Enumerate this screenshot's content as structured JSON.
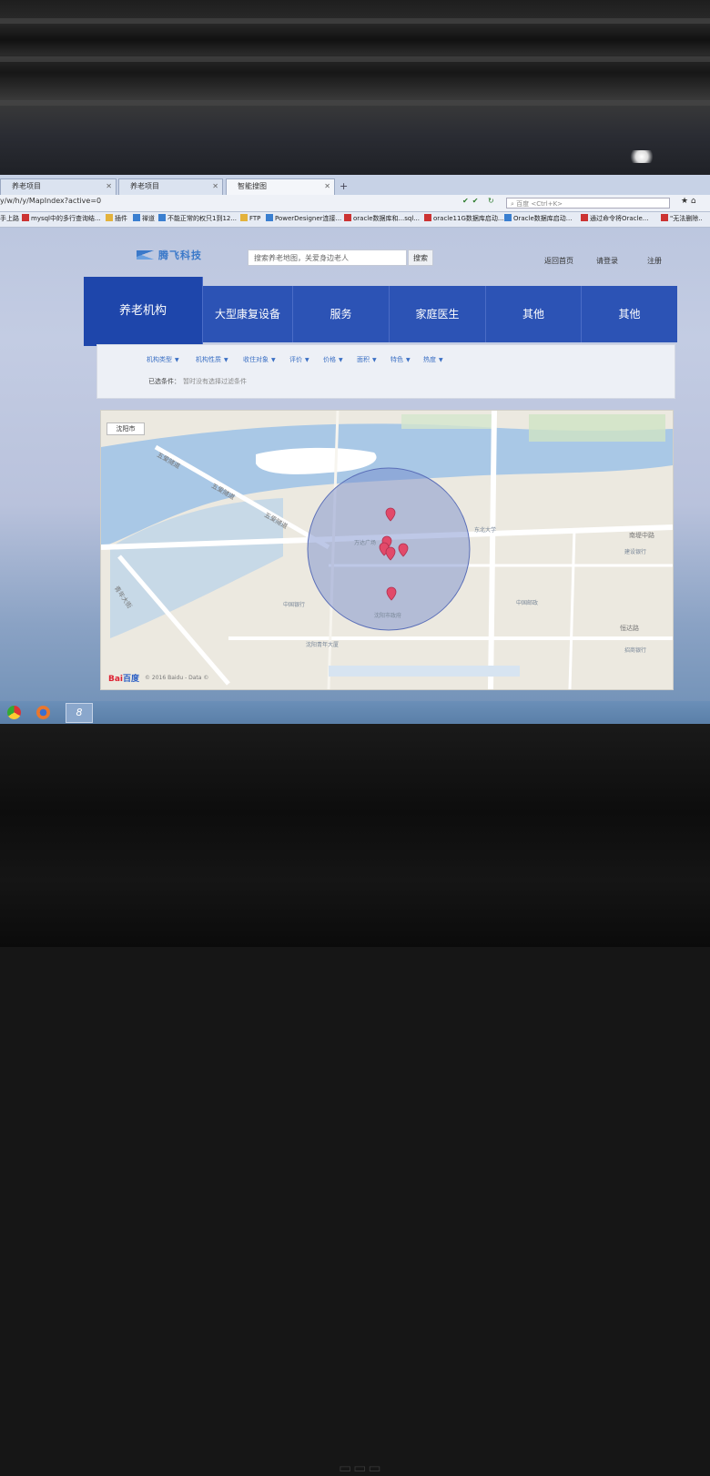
{
  "browser": {
    "tabs": [
      {
        "label": "养老项目",
        "active": false
      },
      {
        "label": "养老项目",
        "active": false
      },
      {
        "label": "智能搜图",
        "active": true
      }
    ],
    "url": "y/w/h/y/MapIndex?active=0",
    "search_placeholder": "百度 <Ctrl+K>",
    "bookmarks": [
      {
        "label": "手上路",
        "icon": "bookmark-icon"
      },
      {
        "label": "mysql中的多行查询结...",
        "icon": "doc-icon"
      },
      {
        "label": "插件",
        "icon": "folder-icon"
      },
      {
        "label": "禅道",
        "icon": "bookmark-icon"
      },
      {
        "label": "不能正常的权只1到12...",
        "icon": "doc-icon"
      },
      {
        "label": "FTP",
        "icon": "folder-icon"
      },
      {
        "label": "PowerDesigner连接...",
        "icon": "doc-icon"
      },
      {
        "label": "oracle数据库和...sql...",
        "icon": "doc-icon"
      },
      {
        "label": "oracle11G数据库启动...",
        "icon": "doc-icon"
      },
      {
        "label": "Oracle数据库启动...",
        "icon": "doc-icon"
      },
      {
        "label": "通过命令将Oracle...",
        "icon": "doc-icon"
      },
      {
        "label": "\"无法删除..",
        "icon": "doc-icon"
      }
    ]
  },
  "site": {
    "logo": "腾飞科技",
    "search_placeholder": "搜索养老地图，关爱身边老人",
    "search_button": "搜索",
    "links": [
      "返回首页",
      "请登录",
      "注册"
    ]
  },
  "nav": {
    "items": [
      "养老机构",
      "大型康复设备",
      "服务",
      "家庭医生",
      "其他",
      "其他"
    ]
  },
  "filters": {
    "items": [
      "机构类型",
      "机构性质",
      "收住对象",
      "评价",
      "价格",
      "面积",
      "特色",
      "热度"
    ],
    "selected_label": "已选条件：",
    "selected_value": "暂时没有选择过滤条件"
  },
  "map": {
    "city": "沈阳市",
    "roads": [
      "五爱隧道",
      "五爱隧道",
      "五爱隧道",
      "南堤中路",
      "青年大街",
      "恒达路"
    ],
    "pois": [
      "中国银行",
      "沈阳青年大厦",
      "东北大学",
      "中国邮政",
      "建设银行",
      "招商银行",
      "万达广场",
      "沈阳市政府"
    ],
    "attribution": "© 2016 Baidu - Data ©",
    "baidu_text": "Bai",
    "baidu_text2": "百度",
    "markers": 6
  },
  "colors": {
    "nav_blue": "#2c53b5",
    "nav_active": "#1e46ab",
    "marker": "#e24a6a",
    "search_circle": "#6f84c9"
  }
}
